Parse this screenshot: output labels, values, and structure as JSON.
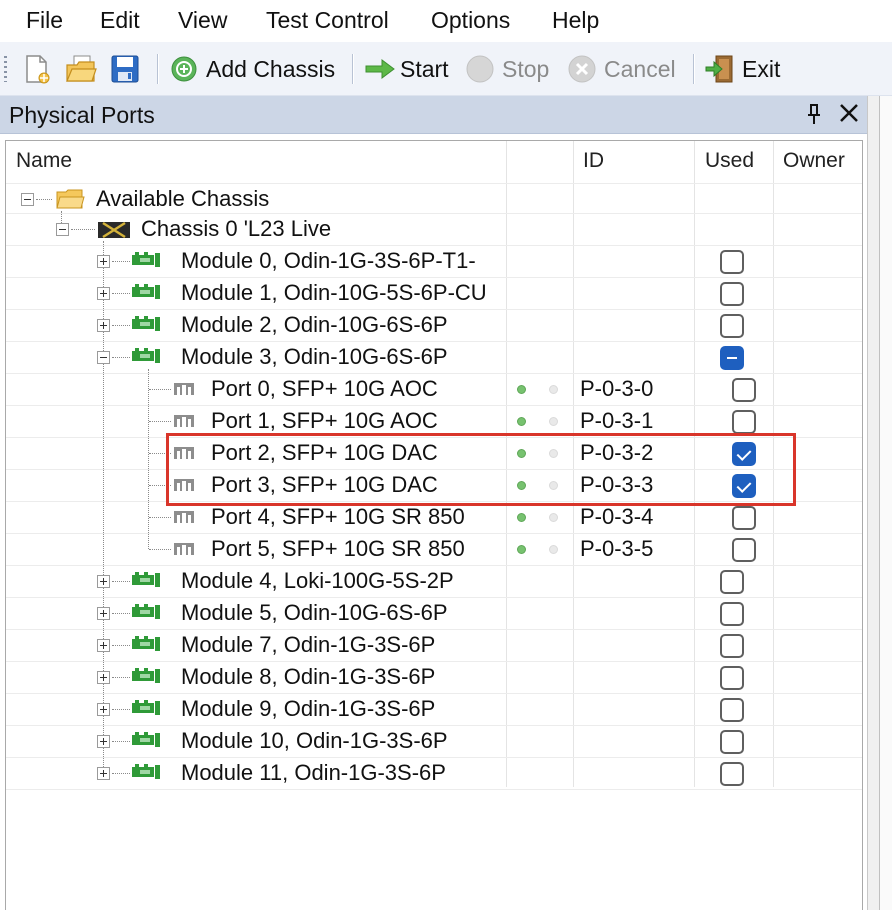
{
  "menu": [
    "File",
    "Edit",
    "View",
    "Test Control",
    "Options",
    "Help"
  ],
  "toolbar": {
    "add_chassis": "Add Chassis",
    "start": "Start",
    "stop": "Stop",
    "cancel": "Cancel",
    "exit": "Exit"
  },
  "panel": {
    "title": "Physical Ports",
    "pin_glyph": "⬇",
    "close_glyph": "✕"
  },
  "columns": {
    "name": "Name",
    "id": "ID",
    "used": "Used",
    "owner": "Owner"
  },
  "tree": {
    "root": "Available Chassis",
    "chassis": "Chassis 0 'L23 Live",
    "modules_top": [
      {
        "label": "Module 0, Odin-1G-3S-6P-T1-",
        "used": "unchecked"
      },
      {
        "label": "Module 1, Odin-10G-5S-6P-CU",
        "used": "unchecked"
      },
      {
        "label": "Module 2, Odin-10G-6S-6P",
        "used": "unchecked"
      },
      {
        "label": "Module 3, Odin-10G-6S-6P",
        "used": "indeterminate"
      }
    ],
    "ports": [
      {
        "label": "Port 0, SFP+ 10G AOC",
        "id": "P-0-3-0",
        "used": "unchecked"
      },
      {
        "label": "Port 1, SFP+ 10G AOC",
        "id": "P-0-3-1",
        "used": "unchecked"
      },
      {
        "label": "Port 2, SFP+ 10G DAC",
        "id": "P-0-3-2",
        "used": "checked"
      },
      {
        "label": "Port 3, SFP+ 10G DAC",
        "id": "P-0-3-3",
        "used": "checked"
      },
      {
        "label": "Port 4, SFP+ 10G SR 850",
        "id": "P-0-3-4",
        "used": "unchecked"
      },
      {
        "label": "Port 5, SFP+ 10G SR 850",
        "id": "P-0-3-5",
        "used": "unchecked"
      }
    ],
    "modules_bottom": [
      {
        "label": "Module 4, Loki-100G-5S-2P",
        "used": "unchecked"
      },
      {
        "label": "Module 5, Odin-10G-6S-6P",
        "used": "unchecked"
      },
      {
        "label": "Module 7, Odin-1G-3S-6P",
        "used": "unchecked"
      },
      {
        "label": "Module 8, Odin-1G-3S-6P",
        "used": "unchecked"
      },
      {
        "label": "Module 9, Odin-1G-3S-6P",
        "used": "unchecked"
      },
      {
        "label": "Module 10, Odin-1G-3S-6P",
        "used": "unchecked"
      },
      {
        "label": "Module 11, Odin-1G-3S-6P",
        "used": "unchecked"
      }
    ]
  },
  "colors": {
    "accent": "#1e5fbf",
    "highlight": "#d9352a",
    "link_up": "#77c26f",
    "module_green": "#2f9a38"
  }
}
